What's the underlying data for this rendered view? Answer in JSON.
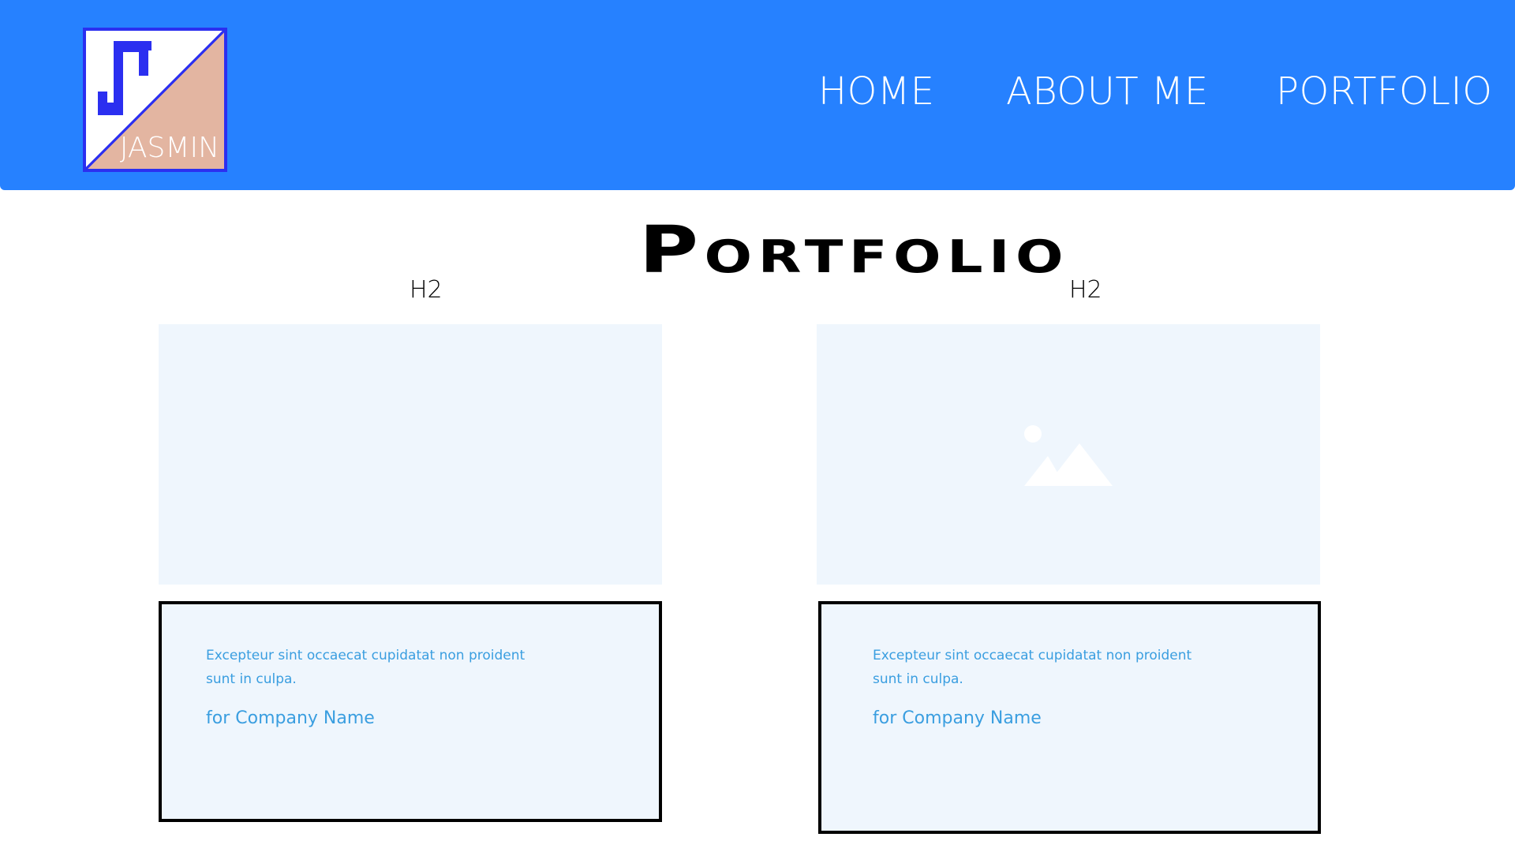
{
  "header": {
    "background_color": "#2681ff",
    "logo": {
      "text": "JASMIN",
      "icon": "monogram-logo-icon",
      "border_color": "#2b2ff0",
      "accent_color": "#e3b5a1"
    },
    "nav": [
      {
        "label": "HOME"
      },
      {
        "label": "ABOUT ME"
      },
      {
        "label": "PORTFOLIO"
      }
    ]
  },
  "main": {
    "title": "Portfolio",
    "annotations": {
      "left": "H2",
      "right": "H2"
    },
    "projects": [
      {
        "image_icon": "",
        "description": "Excepteur sint occaecat cupidatat non proident sunt in culpa.",
        "company": "for Company Name"
      },
      {
        "image_icon": "image-placeholder-icon",
        "description": "Excepteur sint occaecat cupidatat non proident sunt in culpa.",
        "company": "for Company Name"
      }
    ],
    "card_background": "#eff6fd",
    "card_text_color": "#3a9ee0"
  }
}
